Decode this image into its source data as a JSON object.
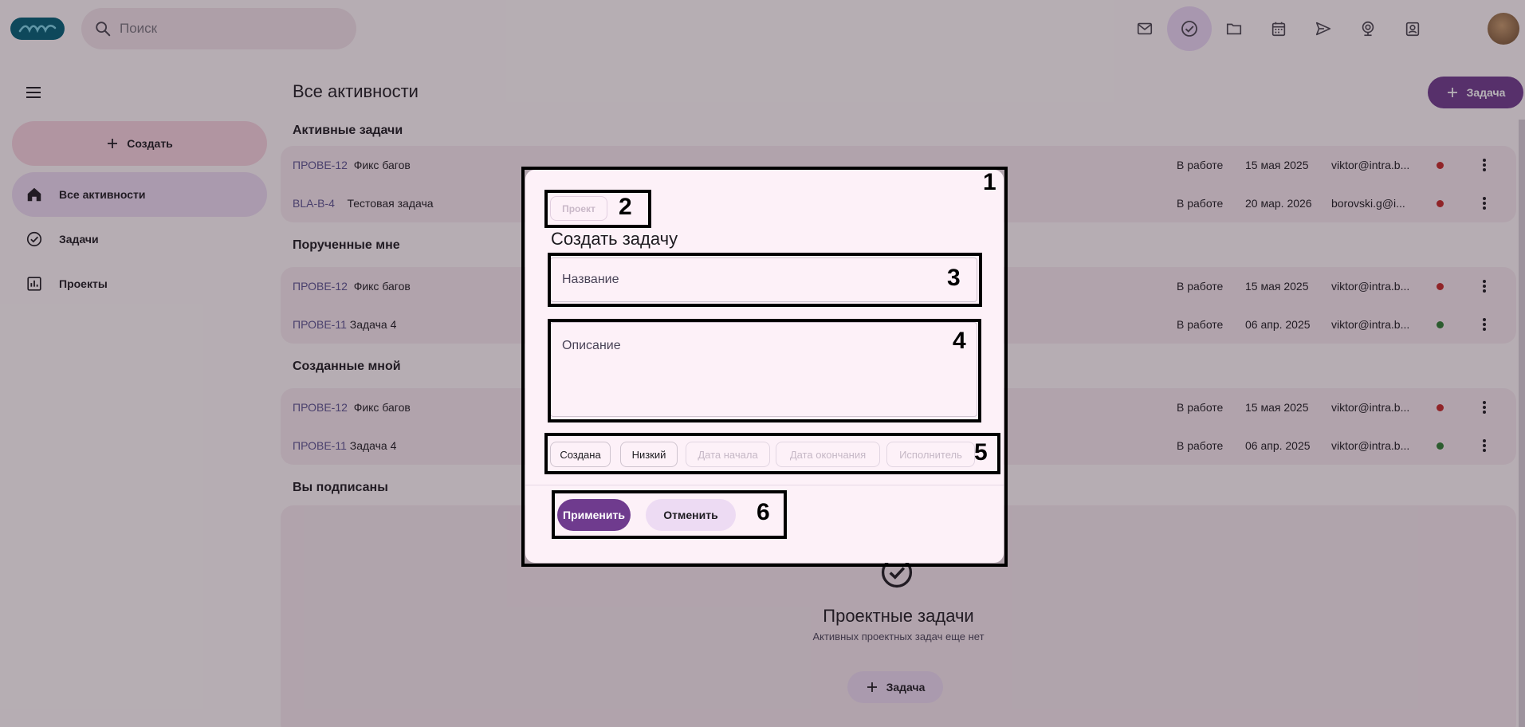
{
  "header": {
    "logo": "logo",
    "search_placeholder": "Поиск",
    "icons": [
      "mail-icon",
      "tasks-icon",
      "folder-icon",
      "calendar-icon",
      "send-icon",
      "webinar-icon",
      "contacts-icon"
    ],
    "active_icon": "tasks-icon"
  },
  "sidebar": {
    "create_label": "Создать",
    "items": [
      {
        "label": "Все активности",
        "icon": "home-icon",
        "active": true
      },
      {
        "label": "Задачи",
        "icon": "check-circle-icon",
        "active": false
      },
      {
        "label": "Проекты",
        "icon": "chart-icon",
        "active": false
      }
    ]
  },
  "main": {
    "title": "Все активности",
    "new_task_label": "Задача",
    "sections": [
      {
        "title": "Активные задачи",
        "rows": [
          {
            "id": "ПРОВЕ-12",
            "name": "Фикс багов",
            "status": "В работе",
            "date": "15 мая 2025",
            "email": "viktor@intra.b...",
            "dot": "#c62828"
          },
          {
            "id": "BLA-B-4",
            "name": "Тестовая задача",
            "status": "В работе",
            "date": "20 мар. 2026",
            "email": "borovski.g@i...",
            "dot": "#c62828"
          }
        ]
      },
      {
        "title": "Порученные мне",
        "rows": [
          {
            "id": "ПРОВЕ-12",
            "name": "Фикс багов",
            "status": "В работе",
            "date": "15 мая 2025",
            "email": "viktor@intra.b...",
            "dot": "#c62828"
          },
          {
            "id": "ПРОВЕ-11",
            "name": "Задача 4",
            "status": "В работе",
            "date": "06 апр. 2025",
            "email": "viktor@intra.b...",
            "dot": "#2e7d32"
          }
        ]
      },
      {
        "title": "Созданные мной",
        "rows": [
          {
            "id": "ПРОВЕ-12",
            "name": "Фикс багов",
            "status": "В работе",
            "date": "15 мая 2025",
            "email": "viktor@intra.b...",
            "dot": "#c62828"
          },
          {
            "id": "ПРОВЕ-11",
            "name": "Задача 4",
            "status": "В работе",
            "date": "06 апр. 2025",
            "email": "viktor@intra.b...",
            "dot": "#2e7d32"
          }
        ]
      }
    ],
    "subscribed_title": "Вы подписаны",
    "empty_state": {
      "title": "Проектные задачи",
      "subtitle": "Активных проектных задач еще нет",
      "button_label": "Задача"
    }
  },
  "dialog": {
    "project_chip": "Проект",
    "title": "Создать задачу",
    "name_placeholder": "Название",
    "description_placeholder": "Описание",
    "chips": [
      "Создана",
      "Низкий",
      "Дата начала",
      "Дата окончания",
      "Исполнитель"
    ],
    "apply_label": "Применить",
    "cancel_label": "Отменить"
  },
  "annotations": [
    "1",
    "2",
    "3",
    "4",
    "5",
    "6"
  ]
}
